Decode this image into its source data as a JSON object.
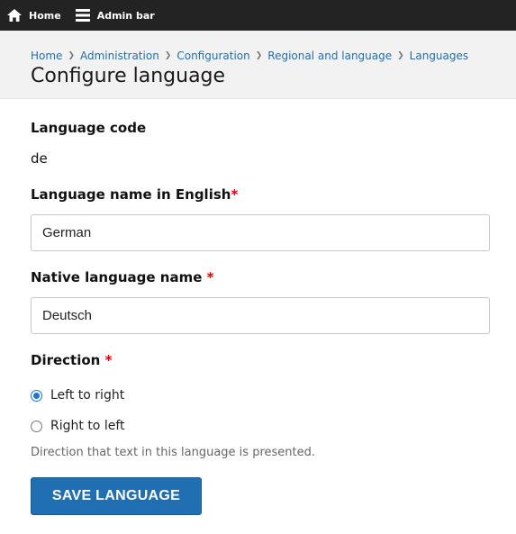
{
  "toolbar": {
    "home_label": "Home",
    "admin_label": "Admin bar"
  },
  "breadcrumb": [
    "Home",
    "Administration",
    "Configuration",
    "Regional and language",
    "Languages"
  ],
  "page_title": "Configure language",
  "form": {
    "code": {
      "label": "Language code",
      "value": "de"
    },
    "name_english": {
      "label": "Language name in English",
      "required_mark": "*",
      "value": "German"
    },
    "native_name": {
      "label": "Native language name",
      "required_mark": "*",
      "value": "Deutsch"
    },
    "direction": {
      "label": "Direction",
      "required_mark": "*",
      "options": [
        {
          "label": "Left to right",
          "selected": true
        },
        {
          "label": "Right to left",
          "selected": false
        }
      ],
      "description": "Direction that text in this language is presented."
    },
    "submit_label": "SAVE LANGUAGE"
  },
  "colors": {
    "accent": "#1f6fb2",
    "toolbar": "#232323",
    "required": "#e00000"
  }
}
